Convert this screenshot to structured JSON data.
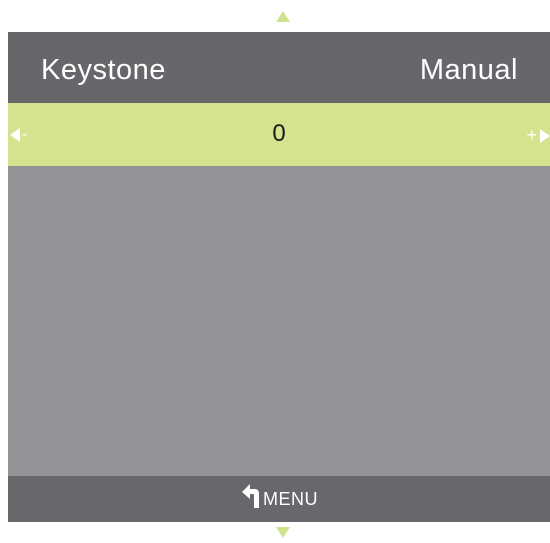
{
  "nav": {
    "up_icon": "triangle-up-icon",
    "down_icon": "triangle-down-icon"
  },
  "header": {
    "title": "Keystone",
    "mode": "Manual"
  },
  "slider": {
    "decrease_label": "-",
    "value": "0",
    "increase_label": "+"
  },
  "footer": {
    "back_icon": "return-arrow-icon",
    "label": "MENU"
  },
  "colors": {
    "accent": "#d4e38d",
    "header_bg": "#66676a",
    "panel_bg": "#929396"
  }
}
